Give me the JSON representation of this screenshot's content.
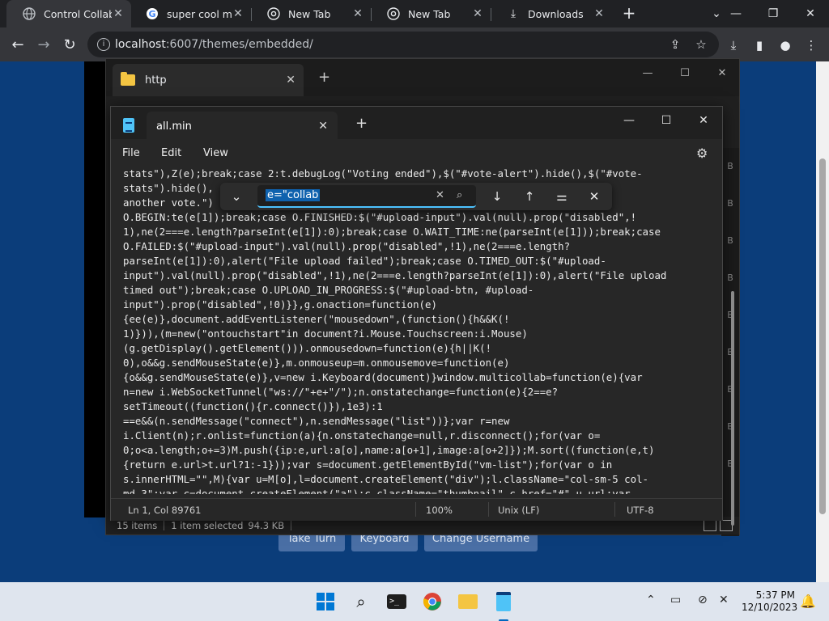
{
  "browser": {
    "tabs": [
      {
        "label": "Control Collaborative",
        "icon": "globe-icon"
      },
      {
        "label": "super cool machine",
        "icon": "google-icon"
      },
      {
        "label": "New Tab",
        "icon": "chrome-icon"
      },
      {
        "label": "New Tab",
        "icon": "chrome-icon"
      },
      {
        "label": "Downloads",
        "icon": "download-icon"
      }
    ],
    "url_host": "localhost",
    "url_rest": ":6007/themes/embedded/"
  },
  "page": {
    "buttons": [
      "Take Turn",
      "Keyboard",
      "Change Username"
    ]
  },
  "explorer": {
    "tab_label": "http",
    "status_items": "15 items",
    "status_selected": "1 item selected",
    "status_size": "94.3 KB"
  },
  "notepad": {
    "tab_label": "all.min",
    "menu": {
      "file": "File",
      "edit": "Edit",
      "view": "View"
    },
    "content": "stats\"),Z(e);break;case 2:t.debugLog(\"Voting ended\"),$(\"#vote-alert\").hide(),$(\"#vote-\nstats\").hide(),                                                     starting\nanother vote.\")\nO.BEGIN:te(e[1]);break;case O.FINISHED:$(\"#upload-input\").val(null).prop(\"disabled\",!\n1),ne(2===e.length?parseInt(e[1]):0);break;case O.WAIT_TIME:ne(parseInt(e[1]));break;case\nO.FAILED:$(\"#upload-input\").val(null).prop(\"disabled\",!1),ne(2===e.length?\nparseInt(e[1]):0),alert(\"File upload failed\");break;case O.TIMED_OUT:$(\"#upload-\ninput\").val(null).prop(\"disabled\",!1),ne(2===e.length?parseInt(e[1]):0),alert(\"File upload\ntimed out\");break;case O.UPLOAD_IN_PROGRESS:$(\"#upload-btn, #upload-\ninput\").prop(\"disabled\",!0)}},g.onaction=function(e)\n{ee(e)},document.addEventListener(\"mousedown\",(function(){h&&K(!\n1)})),(m=new(\"ontouchstart\"in document?i.Mouse.Touchscreen:i.Mouse)\n(g.getDisplay().getElement())).onmousedown=function(e){h||K(!\n0),o&&g.sendMouseState(e)},m.onmouseup=m.onmousemove=function(e)\n{o&&g.sendMouseState(e)},v=new i.Keyboard(document)}window.multicollab=function(e){var\nn=new i.WebSocketTunnel(\"ws://\"+e+\"/\");n.onstatechange=function(e){2==e?\nsetTimeout((function(){r.connect()}),1e3):1\n==e&&(n.sendMessage(\"connect\"),n.sendMessage(\"list\"))};var r=new\ni.Client(n);r.onlist=function(a){n.onstatechange=null,r.disconnect();for(var o=\n0;o<a.length;o+=3)M.push({ip:e,url:a[o],name:a[o+1],image:a[o+2]});M.sort((function(e,t)\n{return e.url>t.url?1:-1}));var s=document.getElementById(\"vm-list\");for(var o in\ns.innerHTML=\"\",M){var u=M[o],l=document.createElement(\"div\");l.className=\"col-sm-5 col-\nmd-3\";var c=document.createElement(\"a\");c.className=\"thumbnail\",c.href=\"#\",u.url;var",
    "status": {
      "position": "Ln 1, Col 89761",
      "zoom": "100%",
      "line_ending": "Unix (LF)",
      "encoding": "UTF-8"
    }
  },
  "findbar": {
    "query": "e=\"collab"
  },
  "taskbar": {
    "time": "5:37 PM",
    "date": "12/10/2023"
  }
}
